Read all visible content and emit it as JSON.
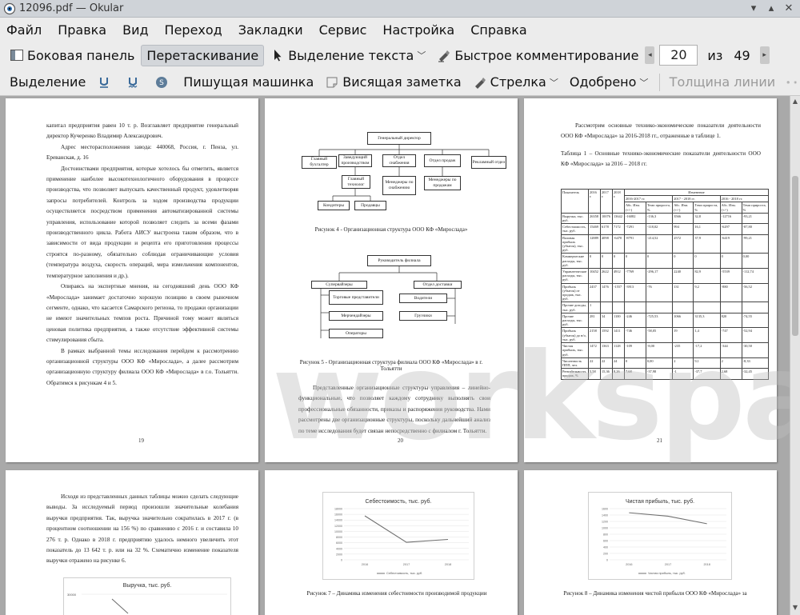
{
  "window": {
    "title": "12096.pdf — Okular"
  },
  "menu": [
    "Файл",
    "Правка",
    "Вид",
    "Переход",
    "Закладки",
    "Сервис",
    "Настройка",
    "Справка"
  ],
  "toolbar1": {
    "sidebar": "Боковая панель",
    "drag": "Перетаскивание",
    "text_select": "Выделение текста",
    "quick_comment": "Быстрое комментирование",
    "page_current": "20",
    "page_of": "из",
    "page_total": "49"
  },
  "toolbar2": {
    "highlight": "Выделение",
    "typewriter": "Пишущая машинка",
    "sticky": "Висящая заметка",
    "arrow": "Стрелка",
    "approved": "Одобрено",
    "line_width": "Толщина линии"
  },
  "watermark": "workspay.ru",
  "pages": {
    "p19": {
      "number": "19",
      "paragraphs": [
        "капитал предприятия равен 10 т. р. Возглавляет предприятие генеральный директор Кучеренко Владимир Александрович.",
        "Адрес месторасположения завода: 440068, Россия, г. Пенза, ул. Ереванская, д. 16",
        "Достоинствами предприятия, которые хотелось бы отметить, является применение наиболее высокотехнологичного оборудования в процессе производства, что позволяет выпускать качественный продукт, удовлетворяя запросы потребителей. Контроль за ходом производства продукции осуществляется посредством применения автоматизированной системы управления, использование которой позволяет следить за всеми фазами производственного цикла. Работа АИСУ выстроена таким образом, что в зависимости от вида продукции и рецепта его приготовления процессы строятся по-разному, обязательно соблюдая ограничивающие условия (температура воздуха, скорость операций, мера измельчения компонентов, температурное заполнения и др.).",
        "Опираясь на экспертные мнения, на сегодняшний день ООО КФ «Мирослада» занимает достаточно хорошую позицию в своем рыночном сегменте, однако, что касается Самарского региона, то продажи организации не имеют значительных темпов роста. Причиной тому может являться ценовая политика предприятия, а также отсутствие эффективной системы стимулирования сбыта.",
        "В рамках выбранной темы исследования перейдем к рассмотрению организационной структуры ООО КФ «Мирослада», а далее рассмотрим организационную структуру филиала ООО КФ «Мирослада» в г.о. Тольятти. Обратимся к рисункам 4 и 5."
      ]
    },
    "p20": {
      "number": "20",
      "org1": {
        "ceo": "Генеральный директор",
        "chief_acc": "Главный бухгалтер",
        "prod_head": "Заведующий производством",
        "supply": "Отдел снабжения",
        "sales": "Отдел продаж",
        "ads": "Рекламный отдел",
        "tech": "Главный технолог",
        "supply_mgr": "Менеджеры по снабжению",
        "sales_mgr": "Менеджеры по продажам",
        "confectioners": "Кондитеры",
        "sellers": "Продавцы"
      },
      "caption4": "Рисунок 4 - Организационная структура ООО КФ «Мирослада»",
      "org2": {
        "head": "Руководитель филиала",
        "supervisors": "Супервайзеры",
        "delivery": "Отдел доставки",
        "reps": "Торговые представители",
        "drivers": "Водители",
        "merch": "Мерчендайзеры",
        "loaders": "Грузчики",
        "operators": "Операторы"
      },
      "caption5": "Рисунок 5 - Организационная структура филиала ООО КФ «Мирослада» в г. Тольятти",
      "paragraph": "Представленные организационные структуры управления – линейно-функциональные, что позволяет каждому сотруднику выполнять свои профессиональные обязанности, приказы и распоряжения руководства. Нами рассмотрены две организационные структуры, поскольку дальнейший анализ по теме исследования будет связан непосредственно с филиалом г. Тольятти."
    },
    "p21": {
      "number": "21",
      "intro": "Рассмотрим основные технико-экономические показатели деятельности ООО КФ «Мирослада» за 2016-2018 гг., отраженные в таблице 1.",
      "table_title": "Таблица 1 – Основные технико-экономические показатели деятельности ООО КФ «Мирослада» за 2016 – 2018 гг.",
      "head": [
        "Показатель",
        "2016 г.",
        "2017 г.",
        "2018 г.",
        "Изменение"
      ],
      "subhead": [
        "2016-2017 гг.",
        "2017 - 2018 гг.",
        "2016 - 2018 гг."
      ],
      "subsub": [
        "Абс. Изм. (+/-)",
        "Темп прироста, %",
        "Абс. Изм. (+/-)",
        "Темп прироста, %",
        "Абс. Изм. (+/-)",
        "Темп прироста, %"
      ],
      "rows": [
        [
          "Выручка, тыс. руб.",
          "26358",
          "10076",
          "13642",
          "-16082",
          "-136,3",
          "3566",
          "32,8",
          "-12716",
          "-93,21"
        ],
        [
          "Себестоимость, тыс. руб.",
          "15469",
          "6178",
          "7172",
          "-7291",
          "-118,02",
          "994",
          "16,1",
          "-6297",
          "-87,80"
        ],
        [
          "Валовая прибыль (убыток), тыс. руб.",
          "12889",
          "4098",
          "-6470",
          "-8791",
          "-214,52",
          "2572",
          "37,9",
          "-6419",
          "-99,21"
        ],
        [
          "Коммерческие расходы, тыс. руб.",
          "0",
          "0",
          "0",
          "0",
          "0",
          "0",
          "0",
          "0",
          "0,00"
        ],
        [
          "Управленческие расходы, тыс. руб.",
          "10452",
          "2622",
          "4912",
          "-7769",
          "-296,17",
          "2240",
          "82,9",
          "-5539",
          "-112,74"
        ],
        [
          "Прибыль (убыток) от продаж, тыс. руб.",
          "2437",
          "1476",
          "-1557",
          "-3913",
          "-76",
          "131",
          "9,2",
          "-880",
          "-56,52"
        ],
        [
          "Прочие доходы, тыс. руб.",
          "1",
          "",
          "",
          "",
          "",
          "",
          "",
          "",
          ""
        ],
        [
          "Прочие расходы, тыс. руб.",
          "281",
          "34",
          "1100",
          "-246",
          "-725,53",
          "1066",
          "3135,3",
          "820",
          "-74,55"
        ],
        [
          "Прибыль (убыток) до н/о, тыс. руб.",
          "2158",
          "1592",
          "1411",
          "-746",
          "-58,05",
          "19",
          "1,4",
          "-747",
          "-52,94"
        ],
        [
          "Чистая прибыль, тыс. руб.",
          "1472",
          "1363",
          "1128",
          "-109",
          "-8,00",
          "-235",
          "-17,2",
          "-344",
          "-30,50"
        ],
        [
          "Численность ППП, чел.",
          "22",
          "22",
          "24",
          "0",
          "0,00",
          "2",
          "9,1",
          "2",
          "-8,33"
        ],
        [
          "Рентабельность продаж, %",
          "5,58",
          "15,36",
          "8,26",
          "7,68",
          "-37,98",
          "-1",
          "-37,7",
          "2,68",
          "-32,45"
        ]
      ]
    },
    "p22": {
      "paragraph": "Исходя из представленных данных таблицы можно сделать следующие выводы. За исследуемый период произошли значительные колебания выручки предприятия. Так, выручка значительно сократилась в 2017 г. (в процентном соотношении на 156 %) по сравнению с 2016 г. и составила 10 276 т. р. Однако в 2018 г. предприятию удалось немного увеличить этот показатель до 13 642 т. р. или на 32 %. Схематично изменение показателя выручки отражено на рисунке 6.",
      "chart_title": "Выручка, тыс. руб.",
      "chart_tick": "30000"
    },
    "p23": {
      "caption": "Рисунок 7 – Динамика изменения себестоимости производимой продукции",
      "legend": "Себестоимость, тыс. руб."
    },
    "p24": {
      "caption": "Рисунок 8 – Динамика изменения чистой прибыли ООО КФ «Мирослада» за",
      "legend": "Чистая прибыль, тыс. руб."
    }
  },
  "chart_data": [
    {
      "type": "line",
      "title": "Себестоимость, тыс. руб.",
      "x": [
        "2016",
        "2017",
        "2018"
      ],
      "series": [
        {
          "name": "Себестоимость, тыс. руб.",
          "values": [
            15469,
            6178,
            7172
          ]
        }
      ],
      "yticks": [
        "0",
        "2000",
        "4000",
        "6000",
        "8000",
        "10000",
        "12000",
        "14000",
        "16000",
        "18000"
      ],
      "ylim": [
        0,
        18000
      ]
    },
    {
      "type": "line",
      "title": "Чистая прибыль, тыс. руб.",
      "x": [
        "2016",
        "2017",
        "2018"
      ],
      "series": [
        {
          "name": "Чистая прибыль, тыс. руб.",
          "values": [
            1472,
            1363,
            1128
          ]
        }
      ],
      "yticks": [
        "0",
        "200",
        "400",
        "600",
        "800",
        "1000",
        "1200",
        "1400",
        "1600"
      ],
      "ylim": [
        0,
        1600
      ]
    }
  ]
}
